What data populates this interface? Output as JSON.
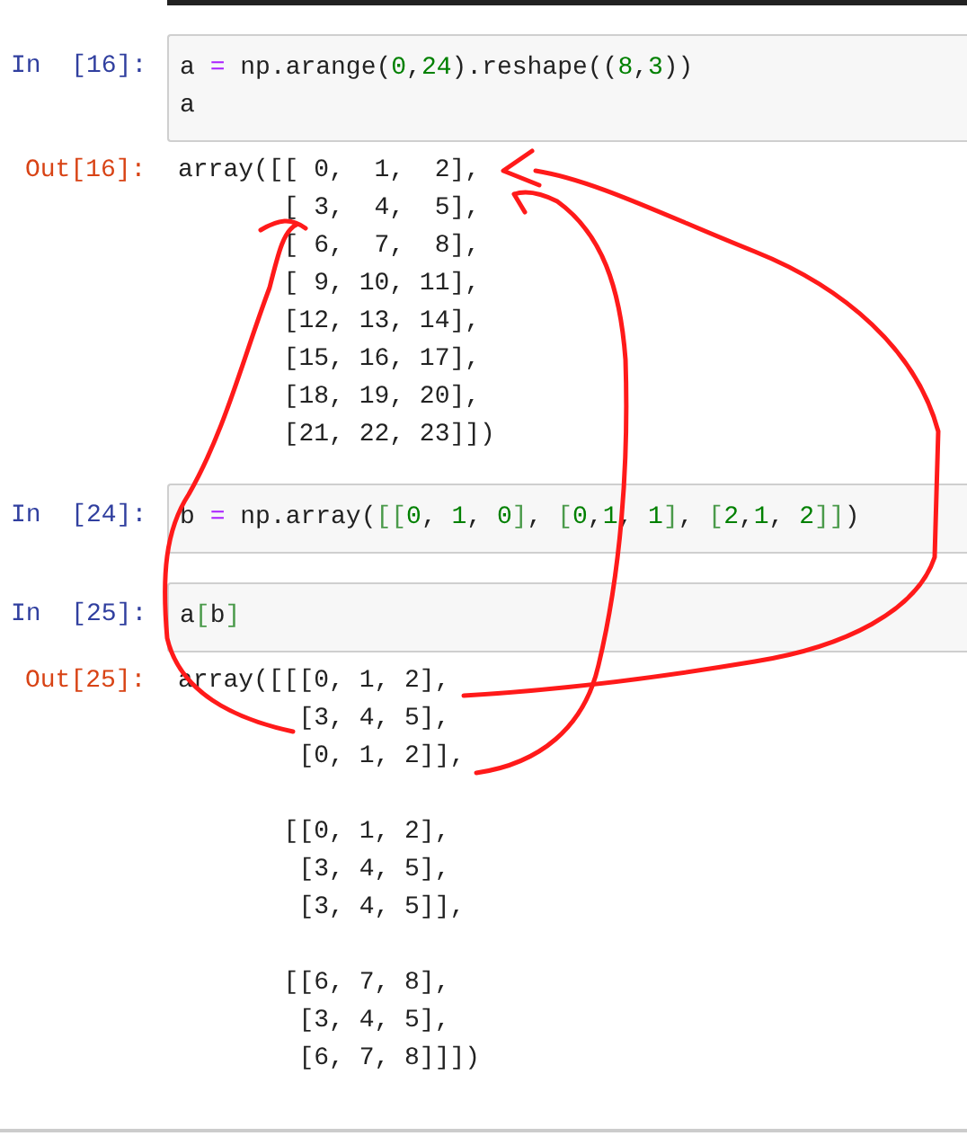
{
  "cells": [
    {
      "kind": "input",
      "prompt": "In  [16]:",
      "code": "a = np.arange(0,24).reshape((8,3))\na"
    },
    {
      "kind": "output",
      "prompt": "Out[16]:",
      "text": "array([[ 0,  1,  2],\n       [ 3,  4,  5],\n       [ 6,  7,  8],\n       [ 9, 10, 11],\n       [12, 13, 14],\n       [15, 16, 17],\n       [18, 19, 20],\n       [21, 22, 23]])"
    },
    {
      "kind": "input",
      "prompt": "In  [24]:",
      "code": "b = np.array([[0, 1, 0], [0,1, 1], [2,1, 2]])"
    },
    {
      "kind": "input",
      "prompt": "In  [25]:",
      "code": "a[b]"
    },
    {
      "kind": "output",
      "prompt": "Out[25]:",
      "text": "array([[[0, 1, 2],\n        [3, 4, 5],\n        [0, 1, 2]],\n\n       [[0, 1, 2],\n        [3, 4, 5],\n        [3, 4, 5]],\n\n       [[6, 7, 8],\n        [3, 4, 5],\n        [6, 7, 8]]])"
    }
  ]
}
